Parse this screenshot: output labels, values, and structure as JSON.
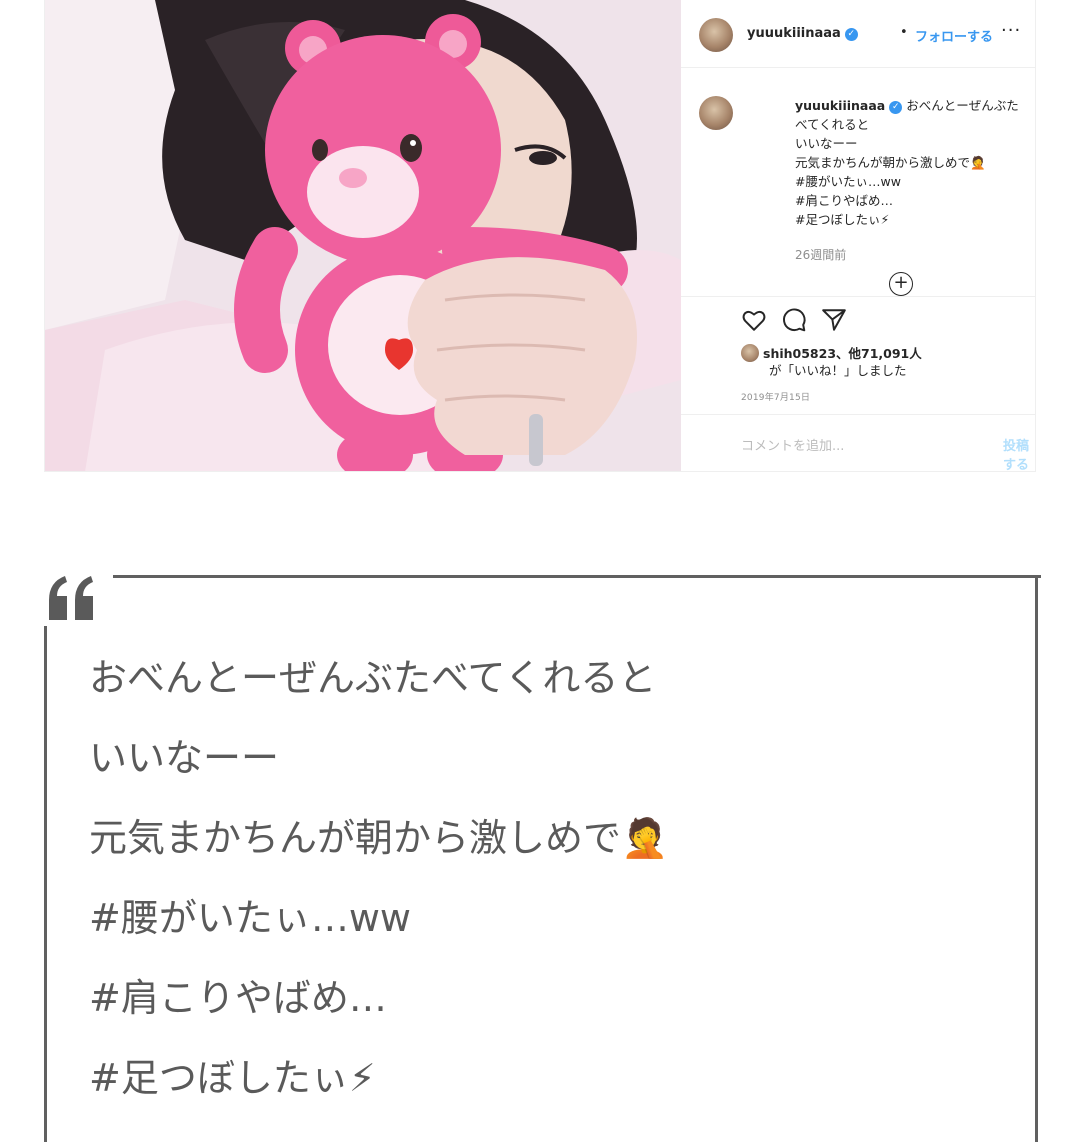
{
  "post": {
    "username": "yuuukiiinaaa",
    "verified_glyph": "✓",
    "separator": "•",
    "follow_label": "フォローする",
    "more_label": "···",
    "caption_username": "yuuukiiinaaa",
    "caption_lines": [
      "おべんとーぜんぶた",
      "べてくれると",
      "いいなーー",
      "元気まかちんが朝から激しめで🤦",
      "#腰がいたぃ…ww",
      "#肩こりやばめ…",
      "#足つぼしたぃ⚡"
    ],
    "time_ago": "26週間前",
    "load_more_label": "+",
    "likes_line1": "shih05823、他71,091人",
    "likes_line2": "が「いいね！」しました",
    "date": "2019年7月15日",
    "comment_placeholder": "コメントを追加...",
    "post_button_label": "投稿する",
    "icons": [
      "heart-icon",
      "comment-icon",
      "share-icon",
      "bookmark-icon",
      "more-icon",
      "load-more-icon"
    ]
  },
  "quote": {
    "mark_icon": "quote-icon",
    "lines": [
      "おべんとーぜんぶたべてくれると",
      "いいなーー",
      "元気まかちんが朝から激しめで🤦",
      "#腰がいたぃ…ww",
      "#肩こりやばめ…",
      "#足つぼしたぃ⚡"
    ]
  },
  "colors": {
    "link_blue": "#3897f0",
    "quote_border": "#606060",
    "quote_text": "#5a5a5a",
    "bear_pink": "#f0609e"
  }
}
